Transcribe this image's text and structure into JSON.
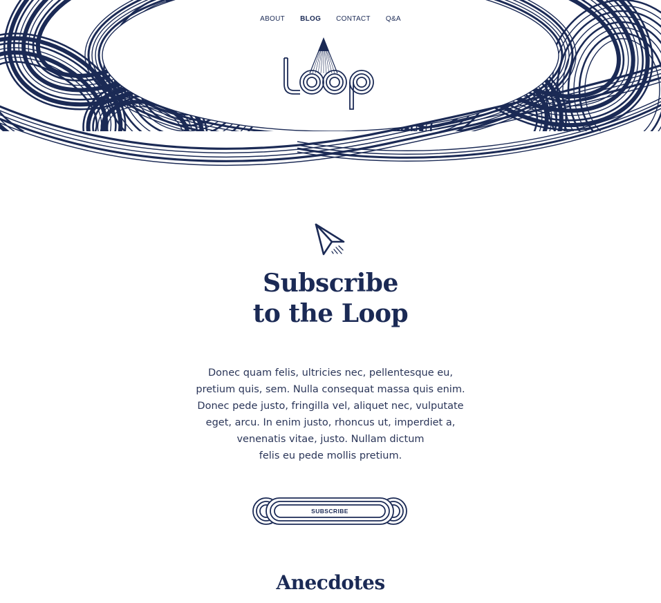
{
  "nav": {
    "items": [
      {
        "label": "ABOUT",
        "active": false
      },
      {
        "label": "BLOG",
        "active": true
      },
      {
        "label": "CONTACT",
        "active": false
      },
      {
        "label": "Q&A",
        "active": false
      }
    ]
  },
  "logo": {
    "text": "Loop",
    "icon": "loop-logo-icon"
  },
  "subscribe": {
    "icon": "paper-plane-icon",
    "title_line1": "Subscribe",
    "title_line2": "to the Loop",
    "body_lines": [
      "Donec quam felis, ultricies nec, pellentesque eu,",
      "pretium quis, sem. Nulla consequat massa quis enim.",
      "Donec pede justo, fringilla vel, aliquet nec, vulputate",
      "eget, arcu. In enim justo, rhoncus ut, imperdiet a,",
      "venenatis vitae, justo. Nullam dictum",
      "felis eu pede mollis pretium."
    ],
    "button_label": "SUBSCRIBE"
  },
  "anecdotes": {
    "heading": "Anecdotes"
  },
  "colors": {
    "navy": "#1b2a55",
    "background": "#ffffff"
  }
}
